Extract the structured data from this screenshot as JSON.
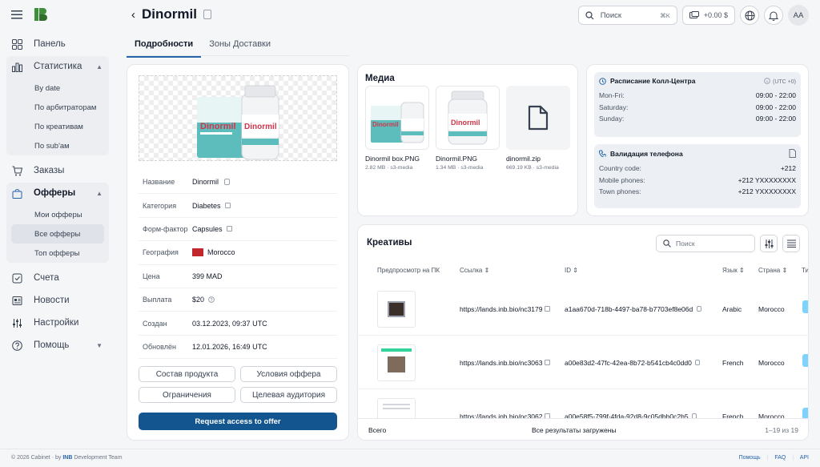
{
  "app": {
    "name": "INB Cabinet"
  },
  "sidebar": {
    "items": [
      {
        "label": "Панель",
        "icon": "dashboard-icon"
      },
      {
        "label": "Статистика",
        "icon": "chart-icon",
        "children": [
          "By date",
          "По арбитраторам",
          "По креативам",
          "По sub'ам"
        ]
      },
      {
        "label": "Заказы",
        "icon": "cart-icon"
      },
      {
        "label": "Офферы",
        "icon": "bag-icon",
        "children": [
          "Мои офферы",
          "Все офферы",
          "Топ офферы"
        ],
        "active_child": "Все офферы"
      },
      {
        "label": "Счета",
        "icon": "invoice-icon"
      },
      {
        "label": "Новости",
        "icon": "news-icon"
      },
      {
        "label": "Настройки",
        "icon": "settings-icon"
      },
      {
        "label": "Помощь",
        "icon": "help-icon"
      }
    ]
  },
  "header": {
    "title": "Dinormil",
    "search_placeholder": "Поиск",
    "search_shortcut": "⌘K",
    "balance": "+0.00 $",
    "avatar_initials": "AA"
  },
  "tabs": [
    {
      "label": "Подробности",
      "active": true
    },
    {
      "label": "Зоны Доставки",
      "active": false
    }
  ],
  "product": {
    "image_brand": "Dinormil",
    "details": [
      {
        "key": "Название",
        "value": "Dinormil"
      },
      {
        "key": "Категория",
        "value": "Diabetes"
      },
      {
        "key": "Форм-фактор",
        "value": "Capsules"
      },
      {
        "key": "География",
        "value": "Morocco"
      },
      {
        "key": "Цена",
        "value": "399 MAD"
      },
      {
        "key": "Выплата",
        "value": "$20"
      },
      {
        "key": "Создан",
        "value": "03.12.2023, 09:37 UTC"
      },
      {
        "key": "Обновлён",
        "value": "12.01.2026, 16:49 UTC"
      }
    ],
    "buttons": [
      "Состав продукта",
      "Условия оффера",
      "Ограничения",
      "Целевая аудитория"
    ],
    "request_label": "Request access to offer"
  },
  "media": {
    "title": "Медиа",
    "items": [
      {
        "name": "Dinormil box.PNG",
        "meta": "2.82 MB · s3-media"
      },
      {
        "name": "Dinormil.PNG",
        "meta": "1.34 MB · s3-media"
      },
      {
        "name": "dinormil.zip",
        "meta": "669.19 KB · s3-media"
      }
    ]
  },
  "call_center": {
    "title": "Расписание Колл-Центра",
    "timezone": "(UTC +0)",
    "rows": [
      {
        "k": "Mon-Fri:",
        "v": "09:00 - 22:00"
      },
      {
        "k": "Saturday:",
        "v": "09:00 - 22:00"
      },
      {
        "k": "Sunday:",
        "v": "09:00 - 22:00"
      }
    ]
  },
  "phone_validation": {
    "title": "Валидация телефона",
    "rows": [
      {
        "k": "Country code:",
        "v": "+212"
      },
      {
        "k": "Mobile phones:",
        "v": "+212 YXXXXXXXX"
      },
      {
        "k": "Town phones:",
        "v": "+212 YXXXXXXXX"
      }
    ]
  },
  "creatives": {
    "title": "Креативы",
    "search_placeholder": "Поиск",
    "columns": [
      "Предпросмотр на ПК",
      "Ссылка",
      "ID",
      "Язык",
      "Страна",
      "Ти"
    ],
    "rows": [
      {
        "link": "https://lands.inb.bio/nc3179",
        "id": "a1aa670d-718b-4497-ba78-b7703ef8e06d",
        "lang": "Arabic",
        "country": "Morocco"
      },
      {
        "link": "https://lands.inb.bio/nc3063",
        "id": "a00e83d2-47fc-42ea-8b72-b541cb4c0dd0",
        "lang": "French",
        "country": "Morocco"
      },
      {
        "link": "https://lands.inb.bio/nc3062",
        "id": "a00e58f5-799f-4fda-92d8-9c05dbb0c2b5",
        "lang": "French",
        "country": "Morocco"
      }
    ],
    "footer_left": "Всего",
    "footer_center": "Все результаты загружены",
    "footer_right": "1–19 из 19"
  },
  "footer": {
    "copyright": "© 2026 Cabinet · by",
    "brand": "INB",
    "team": "Development Team",
    "links": [
      "Помощь",
      "FAQ",
      "API"
    ]
  }
}
